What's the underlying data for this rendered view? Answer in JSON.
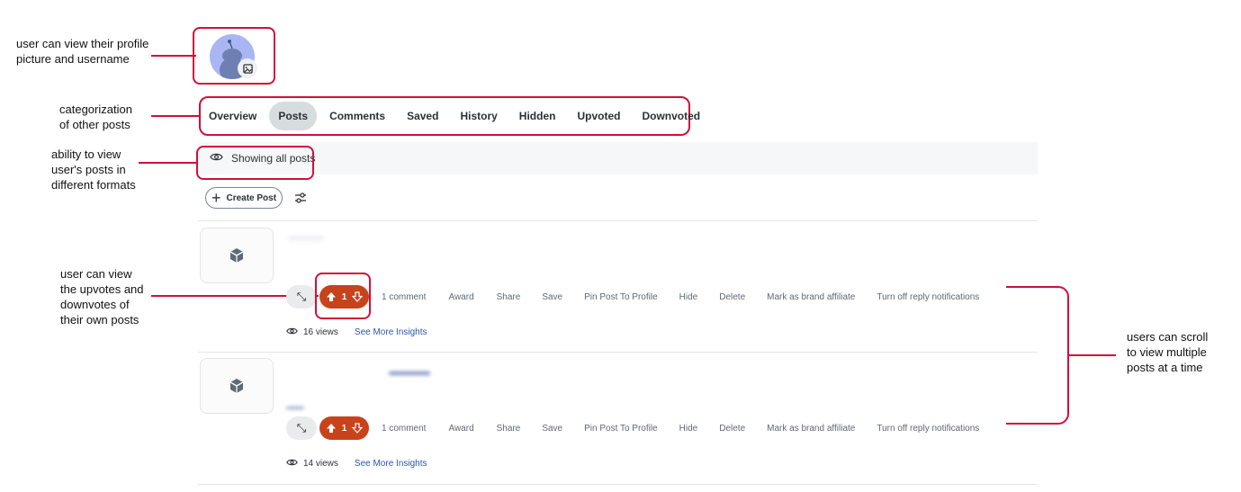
{
  "annotations": {
    "profile": "user can view their profile\npicture and username",
    "categorization": "categorization\nof other posts",
    "formats": "ability to view\nuser's posts in\ndifferent formats",
    "votes": "user can view\nthe upvotes and\ndownvotes of\ntheir own posts",
    "scroll": "users can scroll\nto view multiple\nposts at a time"
  },
  "tabs": [
    {
      "label": "Overview",
      "active": false
    },
    {
      "label": "Posts",
      "active": true
    },
    {
      "label": "Comments",
      "active": false
    },
    {
      "label": "Saved",
      "active": false
    },
    {
      "label": "History",
      "active": false
    },
    {
      "label": "Hidden",
      "active": false
    },
    {
      "label": "Upvoted",
      "active": false
    },
    {
      "label": "Downvoted",
      "active": false
    }
  ],
  "showing_label": "Showing all posts",
  "create_post_label": "Create Post",
  "posts": [
    {
      "votes": "1",
      "actions": [
        "1 comment",
        "Award",
        "Share",
        "Save",
        "Pin Post To Profile",
        "Hide",
        "Delete",
        "Mark as brand affiliate",
        "Turn off reply notifications"
      ],
      "views": "16 views",
      "insights": "See More Insights"
    },
    {
      "votes": "1",
      "actions": [
        "1 comment",
        "Award",
        "Share",
        "Save",
        "Pin Post To Profile",
        "Hide",
        "Delete",
        "Mark as brand affiliate",
        "Turn off reply notifications"
      ],
      "views": "14 views",
      "insights": "See More Insights"
    }
  ],
  "colors": {
    "annotation": "#d0103a",
    "upvote_pill": "#c7431c",
    "link": "#2a55b0",
    "avatar": "#a9b6f4"
  }
}
